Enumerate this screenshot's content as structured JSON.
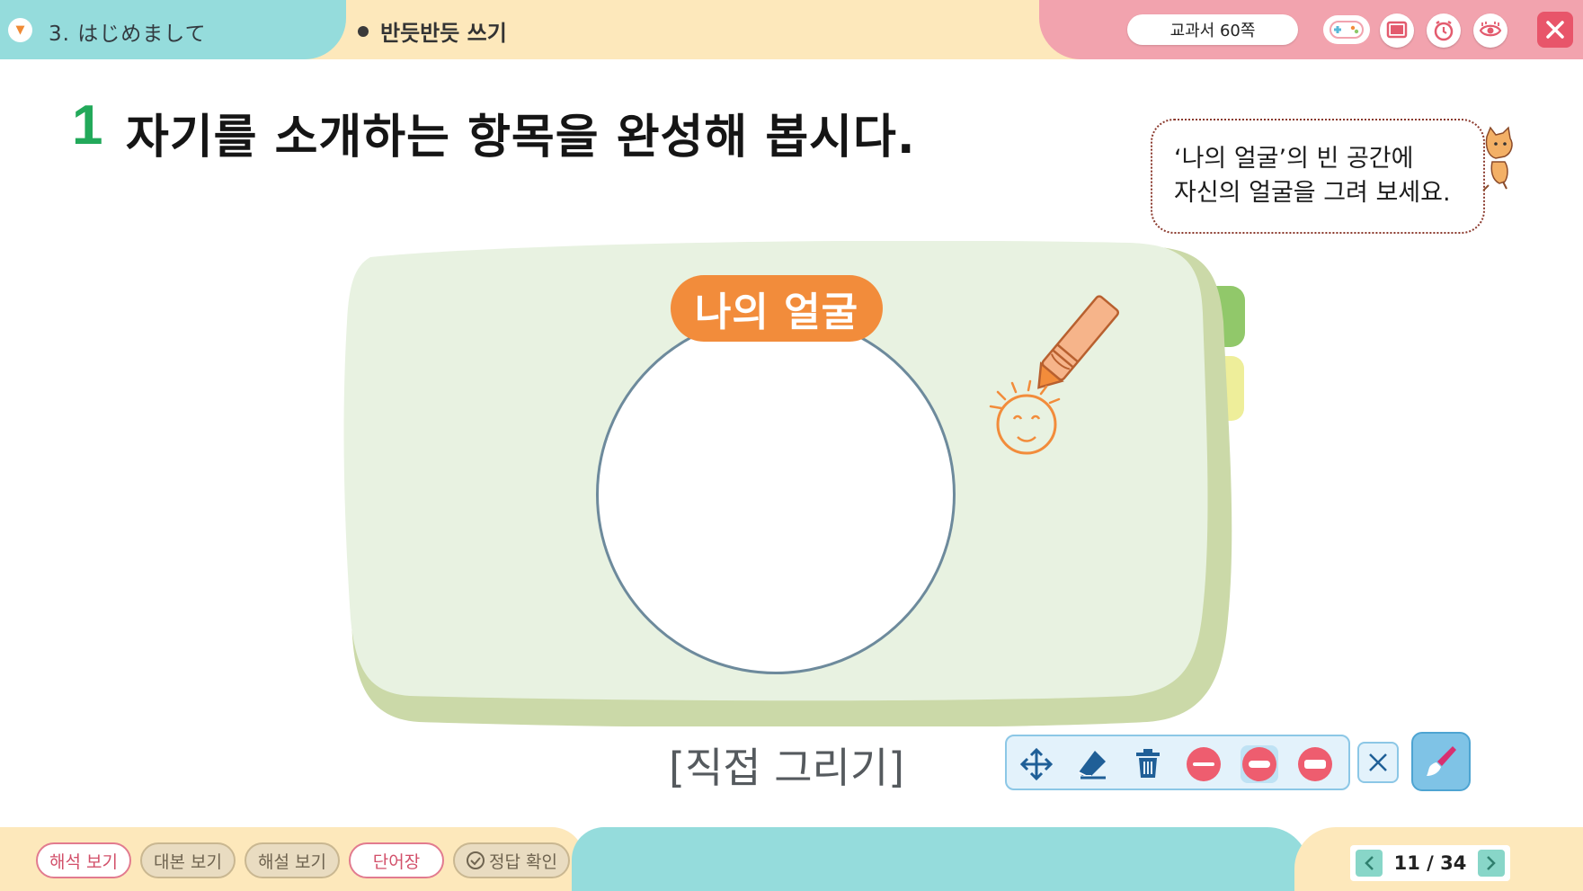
{
  "header": {
    "unit_title": "3. はじめまして",
    "lesson_title": "반듯반듯 쓰기",
    "textbook_page": "교과서  60쪽",
    "icons": [
      "game-controller-icon",
      "screen-icon",
      "timer-icon",
      "eye-icon",
      "close-icon"
    ]
  },
  "question": {
    "number": "1",
    "text": "자기를 소개하는 항목을 완성해 봅시다."
  },
  "tip": {
    "line1": "‘나의 얼굴’의 빈 공간에",
    "line2": "자신의 얼굴을 그려 보세요."
  },
  "card": {
    "title": "나의 얼굴",
    "caption": "[직접 그리기]"
  },
  "toolbar": {
    "tools": [
      "move-icon",
      "eraser-icon",
      "trash-icon",
      "thin-line-icon",
      "medium-line-icon",
      "thick-line-icon"
    ],
    "pen_colors": [
      "#e8556a"
    ],
    "selected_tool": "medium-line-icon"
  },
  "footer": {
    "buttons": [
      "해석 보기",
      "대본 보기",
      "해설 보기",
      "단어장",
      "정답 확인"
    ],
    "page_current": "11",
    "page_total": "34",
    "page_label": "11 / 34"
  },
  "colors": {
    "accent_green": "#22a95a",
    "title_orange": "#f28c3b",
    "header_teal": "#95dcdc",
    "header_pink": "#f2a3ae",
    "header_cream": "#fde8bb",
    "card_green": "#e8f2e1"
  }
}
